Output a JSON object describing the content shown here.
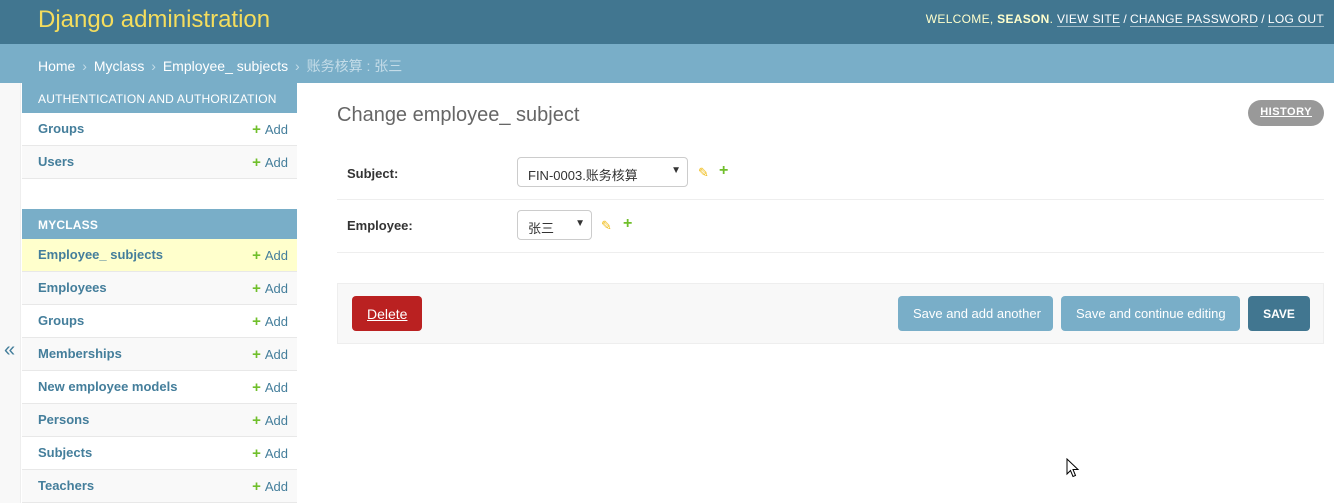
{
  "header": {
    "brand": "Django administration",
    "welcome": "Welcome,",
    "username": "season",
    "view_site": "View site",
    "change_password": "Change password",
    "log_out": "Log out",
    "separator": "/"
  },
  "breadcrumbs": {
    "home": "Home",
    "app": "Myclass",
    "model": "Employee_ subjects",
    "current": "账务核算 : 张三",
    "arrow": "›"
  },
  "sidebar": {
    "toggle": "«",
    "modules": [
      {
        "caption": "Authentication and Authorization",
        "items": [
          {
            "label": "Groups",
            "add": "Add"
          },
          {
            "label": "Users",
            "add": "Add"
          }
        ]
      },
      {
        "caption": "Myclass",
        "items": [
          {
            "label": "Employee_ subjects",
            "add": "Add",
            "current": true
          },
          {
            "label": "Employees",
            "add": "Add"
          },
          {
            "label": "Groups",
            "add": "Add"
          },
          {
            "label": "Memberships",
            "add": "Add"
          },
          {
            "label": "New employee models",
            "add": "Add"
          },
          {
            "label": "Persons",
            "add": "Add"
          },
          {
            "label": "Subjects",
            "add": "Add"
          },
          {
            "label": "Teachers",
            "add": "Add"
          }
        ]
      }
    ]
  },
  "main": {
    "title": "Change employee_ subject",
    "history": "History",
    "fields": {
      "subject": {
        "label": "Subject:",
        "value": "FIN-0003.账务核算"
      },
      "employee": {
        "label": "Employee:",
        "value": "张三"
      }
    },
    "buttons": {
      "delete": "Delete",
      "save_add": "Save and add another",
      "save_continue": "Save and continue editing",
      "save": "Save"
    }
  },
  "icons": {
    "plus": "+",
    "pencil": "✎",
    "caret": "▼"
  },
  "colors": {
    "header_bg": "#417690",
    "brand": "#f5dd5d",
    "breadcrumb_bg": "#79aec8",
    "link": "#447e9b",
    "add_green": "#70bf2b",
    "delete_red": "#ba2121",
    "current_row": "#ffffcc"
  }
}
